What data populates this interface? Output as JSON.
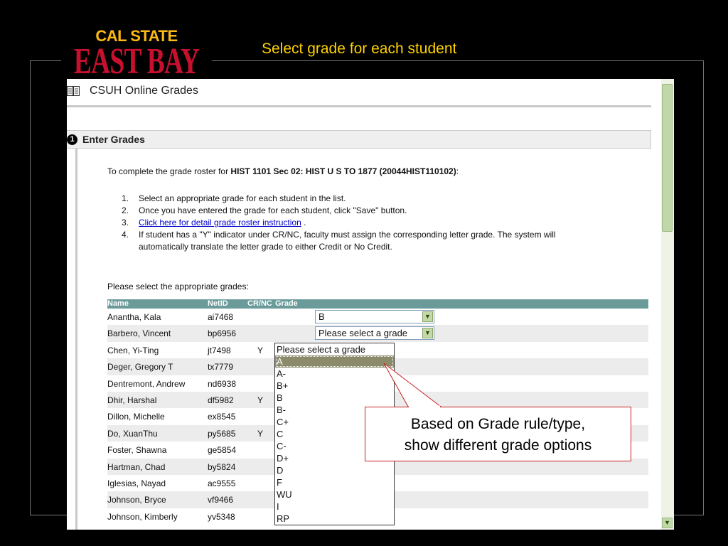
{
  "logo": {
    "line1": "CAL STATE",
    "line2": "EAST BAY"
  },
  "slide_title": "Select grade for each student",
  "app": {
    "title": "CSUH Online Grades",
    "book_icon": "book-icon"
  },
  "section": {
    "number": "1",
    "title": "Enter Grades"
  },
  "intro": {
    "text": "To complete the grade roster for ",
    "course": "HIST 1101 Sec 02: HIST U S TO 1877 (20044HIST110102)",
    "suffix": ":"
  },
  "steps": [
    {
      "num": "1.",
      "text": "Select an appropriate grade for each student in the list."
    },
    {
      "num": "2.",
      "text": "Once you have entered the grade for each student, click \"Save\" button."
    },
    {
      "num": "3.",
      "link": "Click here for detail grade roster instruction",
      "text": " ."
    },
    {
      "num": "4.",
      "text": "If student has a \"Y\" indicator under CR/NC, faculty must assign the corresponding letter grade. The system will automatically translate the letter grade to either Credit or No Credit."
    }
  ],
  "prompt": "Please select the appropriate grades:",
  "table": {
    "headers": {
      "name": "Name",
      "netid": "NetID",
      "crnc": "CR/NC",
      "grade": "Grade"
    },
    "rows": [
      {
        "name": "Anantha, Kala",
        "netid": "ai7468",
        "crnc": "",
        "grade": "B"
      },
      {
        "name": "Barbero, Vincent",
        "netid": "bp6956",
        "crnc": "",
        "grade": "Please select a grade"
      },
      {
        "name": "Chen, Yi-Ting",
        "netid": "jt7498",
        "crnc": "Y",
        "grade": ""
      },
      {
        "name": "Deger, Gregory T",
        "netid": "tx7779",
        "crnc": "",
        "grade": ""
      },
      {
        "name": "Dentremont, Andrew",
        "netid": "nd6938",
        "crnc": "",
        "grade": ""
      },
      {
        "name": "Dhir, Harshal",
        "netid": "df5982",
        "crnc": "Y",
        "grade": ""
      },
      {
        "name": "Dillon, Michelle",
        "netid": "ex8545",
        "crnc": "",
        "grade": ""
      },
      {
        "name": "Do, XuanThu",
        "netid": "py5685",
        "crnc": "Y",
        "grade": ""
      },
      {
        "name": "Foster, Shawna",
        "netid": "ge5854",
        "crnc": "",
        "grade": ""
      },
      {
        "name": "Hartman, Chad",
        "netid": "by5824",
        "crnc": "",
        "grade": ""
      },
      {
        "name": "Iglesias, Nayad",
        "netid": "ac9555",
        "crnc": "",
        "grade": ""
      },
      {
        "name": "Johnson, Bryce",
        "netid": "vf9466",
        "crnc": "",
        "grade": ""
      },
      {
        "name": "Johnson, Kimberly",
        "netid": "yv5348",
        "crnc": "",
        "grade": ""
      }
    ]
  },
  "dropdown": {
    "options": [
      "Please select a grade",
      "A",
      "A-",
      "B+",
      "B",
      "B-",
      "C+",
      "C",
      "C-",
      "D+",
      "D",
      "F",
      "WU",
      "I",
      "RP"
    ],
    "highlighted": "A"
  },
  "callout": {
    "line1": "Based on Grade rule/type,",
    "line2": "show different grade options"
  },
  "colors": {
    "background": "#000000",
    "title": "#FFD200",
    "logo_gold": "#FDB913",
    "logo_red": "#C8102E",
    "table_header": "#6A9A9A",
    "callout_border": "#C62020"
  }
}
